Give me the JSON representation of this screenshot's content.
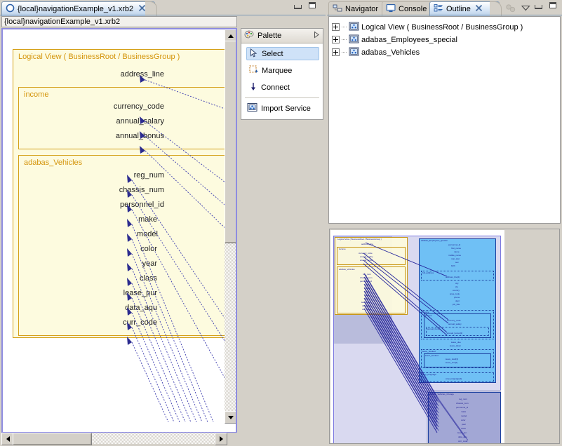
{
  "editor": {
    "tab_label": "{local}navigationExample_v1.xrb2",
    "tab_icon": "circle-icon",
    "close_icon": "close-icon",
    "minimize_icon": "minimize-icon",
    "maximize_icon": "maximize-icon",
    "path_label": "{local}navigationExample_v1.xrb2",
    "diagram": {
      "outer_group_label": "Logical View   ( BusinessRoot / BusinessGroup )",
      "groups": [
        {
          "label": "income",
          "fields": [
            "currency_code",
            "annual_salary",
            "annual_bonus"
          ]
        },
        {
          "label": "adabas_Vehicles",
          "fields": [
            "reg_num",
            "chassis_num",
            "personnel_id",
            "make",
            "model",
            "color",
            "year",
            "class",
            "lease_pur",
            "data_aqu",
            "curr_code"
          ]
        }
      ],
      "top_field": "address_line"
    }
  },
  "palette": {
    "title": "Palette",
    "title_icon": "palette-icon",
    "collapse_icon": "chevron-right-icon",
    "items": [
      {
        "label": "Select",
        "icon": "cursor-icon",
        "selected": true
      },
      {
        "label": "Marquee",
        "icon": "marquee-icon",
        "selected": false
      },
      {
        "label": "Connect",
        "icon": "arrow-down-icon",
        "selected": false
      }
    ],
    "tools": [
      {
        "label": "Import Service",
        "icon": "import-service-icon"
      }
    ]
  },
  "right_views": {
    "tabs": [
      {
        "label": "Navigator",
        "icon": "navigator-icon",
        "active": false,
        "closable": false
      },
      {
        "label": "Console",
        "icon": "console-icon",
        "active": false,
        "closable": false
      },
      {
        "label": "Outline",
        "icon": "outline-icon",
        "active": true,
        "closable": true
      }
    ],
    "toolbar": [
      {
        "icon": "link-with-editor-icon",
        "disabled": true
      },
      {
        "icon": "view-menu-icon",
        "disabled": false
      },
      {
        "icon": "minimize-icon",
        "disabled": false
      },
      {
        "icon": "maximize-icon",
        "disabled": false
      }
    ],
    "outline_tree": [
      {
        "label": "Logical View   ( BusinessRoot / BusinessGroup )",
        "icon": "business-group-icon",
        "expander": "plus"
      },
      {
        "label": "adabas_Employees_special",
        "icon": "business-group-icon",
        "expander": "plus"
      },
      {
        "label": "adabas_Vehicles",
        "icon": "business-group-icon",
        "expander": "plus"
      }
    ]
  },
  "thumbnail": {
    "name": "outline-thumbnail",
    "left_group_label": "Logical View  ( BusinessRoot / BusinessGroup )",
    "left_sub_labels": [
      "income",
      "adabas_Vehicles"
    ],
    "right_group_label": "adabas_Employees_special",
    "bottom_group_label": "adabas_Vehicles"
  },
  "colors": {
    "group_border": "#d4a017",
    "group_fill": "#fdfbdf",
    "group_label": "#d4940a",
    "connector": "#2b2b8f",
    "tab_active_top": "#ffffff",
    "tab_active_bottom": "#b8cfe8",
    "chrome": "#d4d0c8",
    "selection": "#cfe2f8",
    "thumb_blue": "#6fc0f5",
    "viewport": "#7b78e0"
  },
  "scrollbars": {
    "editor_v_thumb_label": "vertical-scroll-thumb",
    "editor_h_thumb_label": "horizontal-scroll-thumb"
  }
}
